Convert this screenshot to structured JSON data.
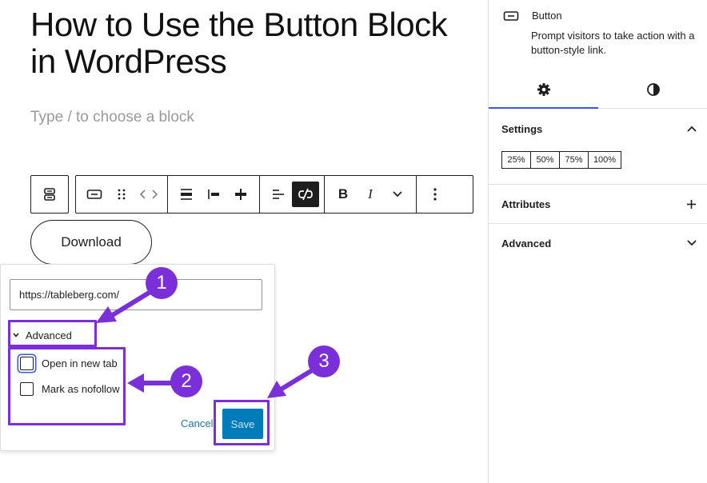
{
  "editor": {
    "post_title": "How to Use the Button Block in WordPress",
    "block_placeholder": "Type / to choose a block",
    "button_text": "Download"
  },
  "toolbar": {
    "groups": [
      [
        "button-icon",
        "drag-handle-icon",
        "move-arrows-icon"
      ],
      [
        "justify-left-icon",
        "justify-center-icon",
        "justify-stretch-icon"
      ],
      [
        "align-left-icon",
        "unlink-icon"
      ],
      [
        "bold-icon",
        "italic-icon",
        "chevron-down-icon"
      ],
      [
        "more-options-icon"
      ]
    ],
    "bold_label": "B",
    "italic_label": "I"
  },
  "link_popover": {
    "url_value": "https://tableberg.com/",
    "advanced_label": "Advanced",
    "open_new_tab_label": "Open in new tab",
    "nofollow_label": "Mark as nofollow",
    "cancel_label": "Cancel",
    "save_label": "Save"
  },
  "annotations": {
    "markers": [
      "1",
      "2",
      "3"
    ],
    "color": "#7b2fd9"
  },
  "sidebar": {
    "block_title": "Button",
    "block_description": "Prompt visitors to take action with a button-style link.",
    "tabs": [
      "settings-gear-icon",
      "styles-contrast-icon"
    ],
    "panels": {
      "settings": {
        "title": "Settings",
        "width_options": [
          "25%",
          "50%",
          "75%",
          "100%"
        ]
      },
      "attributes": {
        "title": "Attributes"
      },
      "advanced": {
        "title": "Advanced"
      }
    }
  },
  "colors": {
    "accent": "#3858e9",
    "save_button": "#007cba",
    "link": "#2271b1",
    "annotation": "#7b2fd9"
  }
}
